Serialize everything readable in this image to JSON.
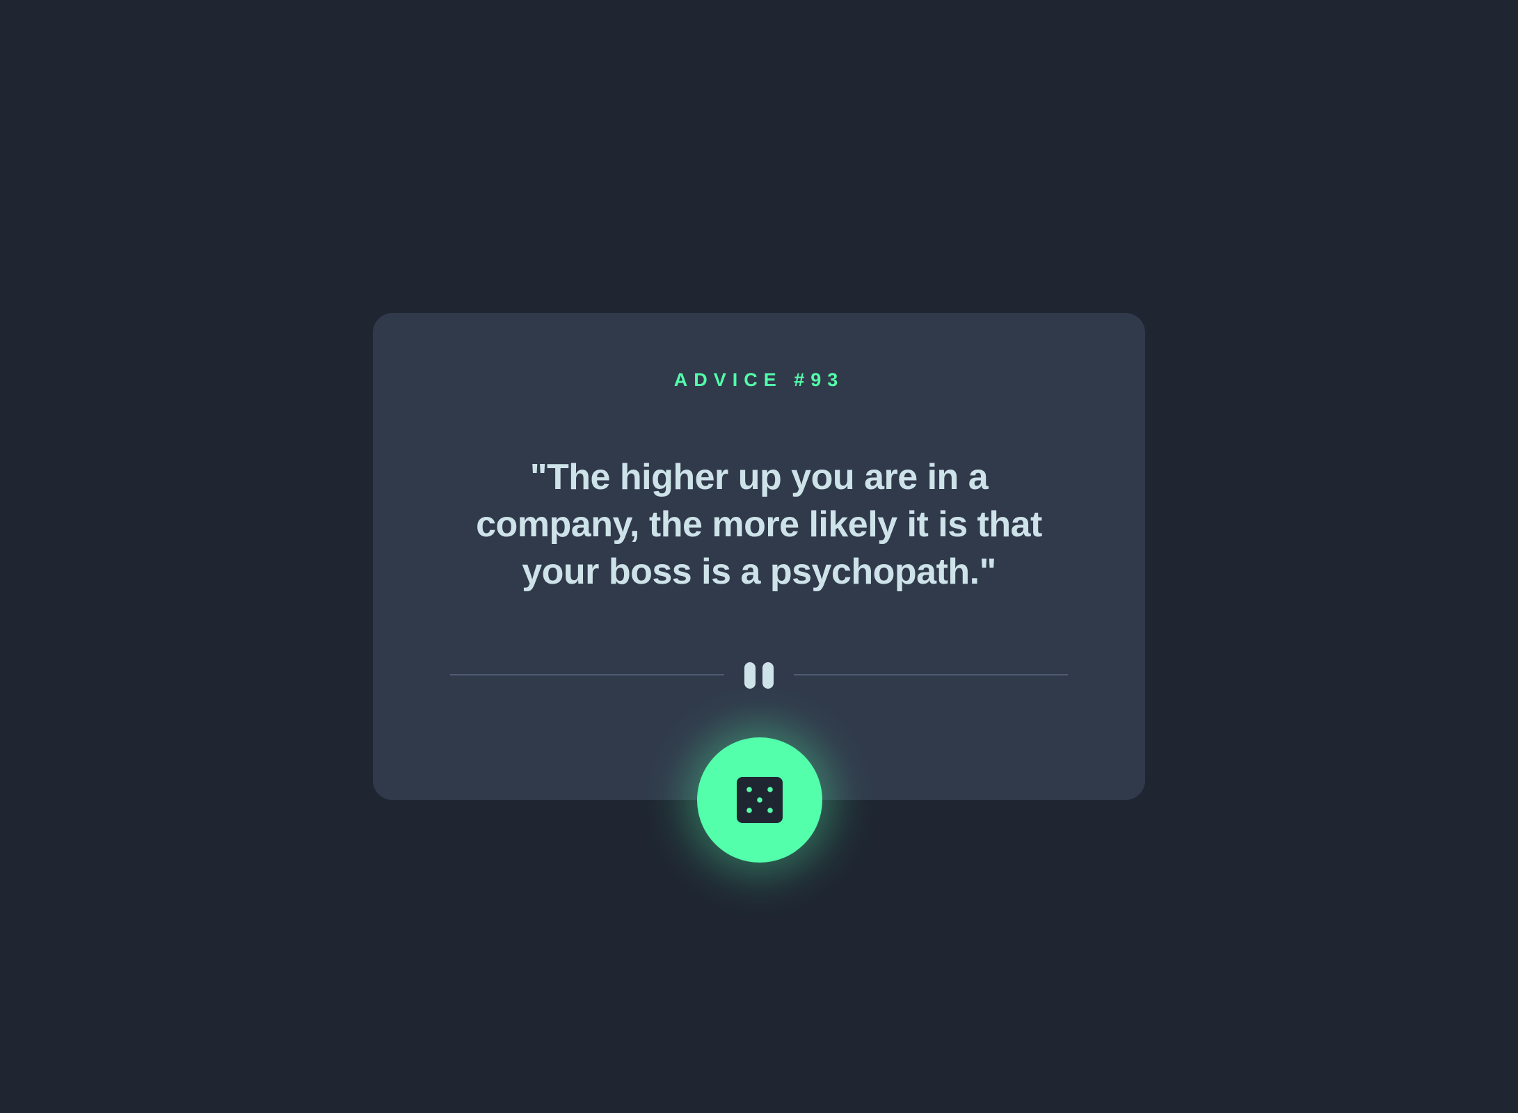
{
  "advice": {
    "label": "ADVICE #93",
    "quote": "\"The higher up you are in a company, the more likely it is that your boss is a psychopath.\""
  },
  "divider": {
    "icon": "pause-icon"
  },
  "button": {
    "icon": "dice-icon"
  },
  "colors": {
    "background": "#1f2632",
    "card": "#313a4b",
    "accent": "#53ffaa",
    "text": "#cee3e9",
    "divider": "#4f5d74"
  }
}
